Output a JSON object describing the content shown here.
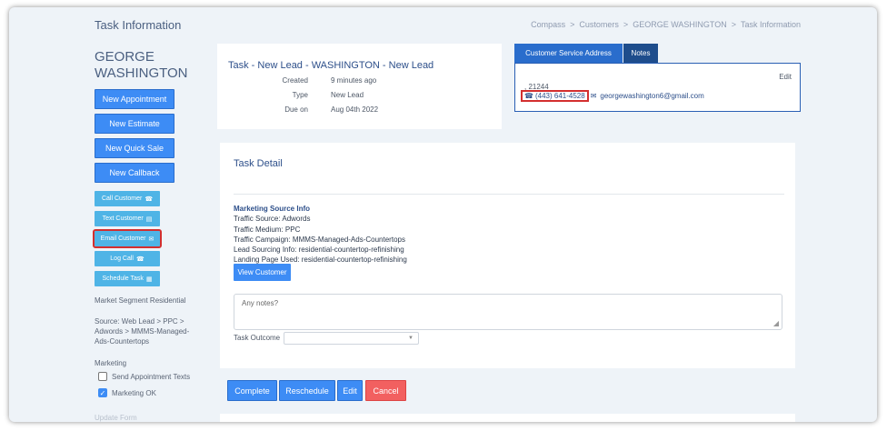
{
  "header": {
    "page_title": "Task Information",
    "breadcrumb": [
      "Compass",
      "Customers",
      "GEORGE WASHINGTON",
      "Task Information"
    ],
    "breadcrumb_sep": ">"
  },
  "sidebar": {
    "customer_name": "GEORGE WASHINGTON",
    "primary_buttons": [
      "New Appointment",
      "New Estimate",
      "New Quick Sale",
      "New Callback"
    ],
    "small_buttons": [
      {
        "label": "Call Customer",
        "icon": "phone-icon"
      },
      {
        "label": "Text Customer",
        "icon": "message-icon"
      },
      {
        "label": "Email Customer",
        "icon": "envelope-icon"
      },
      {
        "label": "Log Call",
        "icon": "phone-icon"
      },
      {
        "label": "Schedule Task",
        "icon": "calendar-icon"
      }
    ],
    "market_segment": "Market Segment Residential",
    "source": "Source: Web Lead > PPC > Adwords > MMMS-Managed-Ads-Countertops",
    "marketing_heading": "Marketing",
    "checkboxes": [
      {
        "label": "Send Appointment Texts",
        "checked": false
      },
      {
        "label": "Marketing OK",
        "checked": true
      }
    ],
    "cut_text": "Update Form"
  },
  "task_card": {
    "title": "Task - New Lead - WASHINGTON - New Lead",
    "rows": [
      {
        "label": "Created",
        "value": "9 minutes ago"
      },
      {
        "label": "Type",
        "value": "New Lead"
      },
      {
        "label": "Due on",
        "value": "Aug 04th 2022"
      }
    ]
  },
  "address_panel": {
    "tabs": [
      "Customer Service Address",
      "Notes"
    ],
    "edit_label": "Edit",
    "address": ", 21244",
    "phone": "(443) 641-4528",
    "email": "georgewashington6@gmail.com"
  },
  "task_detail": {
    "title": "Task Detail",
    "marketing_heading": "Marketing Source Info",
    "lines": [
      "Traffic Source: Adwords",
      "Traffic Medium: PPC",
      "Traffic Campaign: MMMS-Managed-Ads-Countertops",
      "Lead Sourcing Info: residential-countertop-refinishing",
      "Landing Page Used: residential-countertop-refinishing"
    ],
    "view_customer": "View Customer",
    "notes_placeholder": "Any notes?",
    "outcome_label": "Task Outcome",
    "outcome_value": ""
  },
  "actions": {
    "complete": "Complete",
    "reschedule": "Reschedule",
    "edit": "Edit",
    "cancel": "Cancel"
  },
  "colors": {
    "primary": "#3d8cf5",
    "light_blue": "#4fb4e6",
    "danger": "#f26060",
    "navy_tab": "#1e4d8c",
    "highlight": "#d32f2f"
  }
}
